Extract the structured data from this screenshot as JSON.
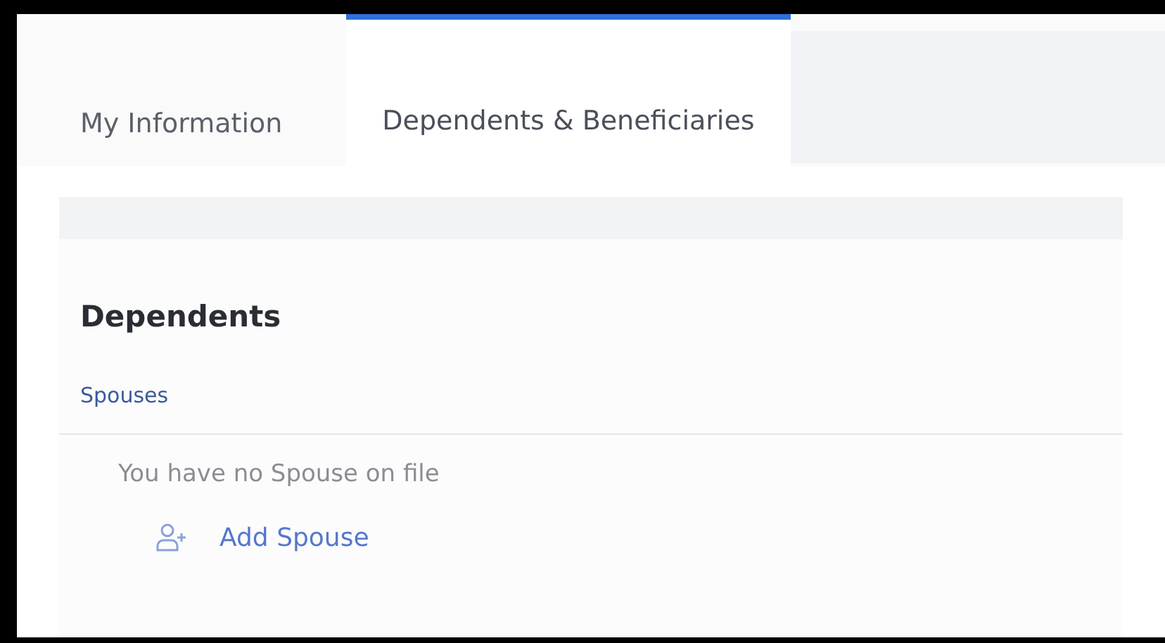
{
  "tabs": [
    {
      "label": "My Information",
      "selected": false
    },
    {
      "label": "Dependents & Beneficiaries",
      "selected": true
    }
  ],
  "section": {
    "title": "Dependents",
    "subsection": "Spouses",
    "empty_message": "You have no Spouse on file",
    "add_link": "Add Spouse"
  }
}
